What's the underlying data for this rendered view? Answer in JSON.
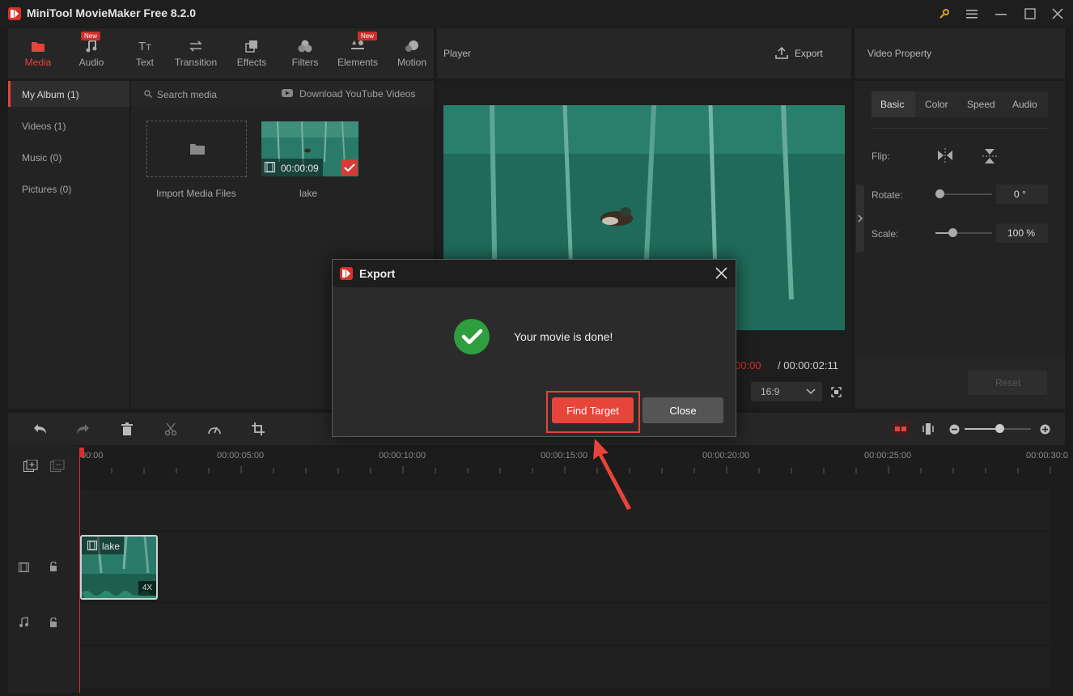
{
  "app": {
    "title": "MiniTool MovieMaker Free 8.2.0"
  },
  "toolbar": {
    "tabs": [
      {
        "label": "Media",
        "icon": "folder-icon",
        "new": false
      },
      {
        "label": "Audio",
        "icon": "music-note-icon",
        "new": true
      },
      {
        "label": "Text",
        "icon": "text-icon",
        "new": false
      },
      {
        "label": "Transition",
        "icon": "transition-arrows-icon",
        "new": false
      },
      {
        "label": "Effects",
        "icon": "effects-icon",
        "new": false
      },
      {
        "label": "Filters",
        "icon": "filters-icon",
        "new": false
      },
      {
        "label": "Elements",
        "icon": "elements-icon",
        "new": true
      },
      {
        "label": "Motion",
        "icon": "motion-icon",
        "new": false
      }
    ],
    "new_badge": "New"
  },
  "media": {
    "albums": [
      "My Album (1)",
      "Videos (1)",
      "Music (0)",
      "Pictures (0)"
    ],
    "search_placeholder": "Search media",
    "download_label": "Download YouTube Videos",
    "import_label": "Import Media Files",
    "clip": {
      "name": "lake",
      "duration": "00:00:09"
    }
  },
  "player": {
    "title": "Player",
    "export_label": "Export",
    "time_current": "00:00:00",
    "time_total": "/ 00:00:02:11",
    "time_current_visible": "00:00",
    "aspect": "16:9"
  },
  "properties": {
    "title": "Video Property",
    "tabs": [
      "Basic",
      "Color",
      "Speed",
      "Audio"
    ],
    "flip_label": "Flip:",
    "rotate_label": "Rotate:",
    "rotate_value": "0 °",
    "scale_label": "Scale:",
    "scale_value": "100 %",
    "reset_label": "Reset"
  },
  "timeline": {
    "ruler": [
      "00:00",
      "00:00:05:00",
      "00:00:10:00",
      "00:00:15:00",
      "00:00:20:00",
      "00:00:25:00",
      "00:00:30:0"
    ],
    "clip_name": "lake",
    "clip_speed": "4X"
  },
  "dialog": {
    "title": "Export",
    "message": "Your movie is done!",
    "find_target": "Find Target",
    "close": "Close"
  },
  "colors": {
    "accent": "#e4443a",
    "success": "#2e9e3e",
    "highlight_box": "#e4443a"
  }
}
